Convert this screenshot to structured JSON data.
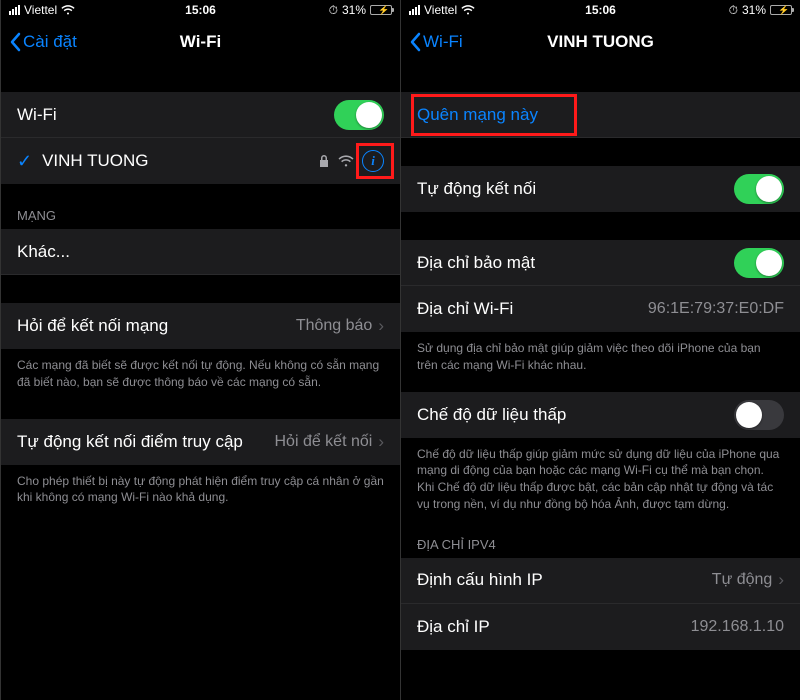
{
  "status": {
    "carrier": "Viettel",
    "time": "15:06",
    "battery_pct": "31%"
  },
  "left": {
    "back": "Cài đặt",
    "title": "Wi-Fi",
    "wifi_toggle_label": "Wi-Fi",
    "network_name": "VINH TUONG",
    "networks_header": "MẠNG",
    "other": "Khác...",
    "ask_join_label": "Hỏi để kết nối mạng",
    "ask_join_value": "Thông báo",
    "ask_join_note": "Các mạng đã biết sẽ được kết nối tự động. Nếu không có sẵn mạng đã biết nào, bạn sẽ được thông báo về các mạng có sẵn.",
    "hotspot_label": "Tự động kết nối điểm truy cập",
    "hotspot_value": "Hỏi để kết nối",
    "hotspot_note": "Cho phép thiết bị này tự động phát hiện điểm truy cập cá nhân ở gần khi không có mạng Wi-Fi nào khả dụng."
  },
  "right": {
    "back": "Wi-Fi",
    "title": "VINH TUONG",
    "forget": "Quên mạng này",
    "auto_join": "Tự động kết nối",
    "private_addr": "Địa chỉ bảo mật",
    "wifi_addr_label": "Địa chỉ Wi-Fi",
    "wifi_addr_value": "96:1E:79:37:E0:DF",
    "private_note": "Sử dụng địa chỉ bảo mật giúp giảm việc theo dõi iPhone của bạn trên các mạng Wi-Fi khác nhau.",
    "low_data": "Chế độ dữ liệu thấp",
    "low_data_note": "Chế độ dữ liệu thấp giúp giảm mức sử dụng dữ liệu của iPhone qua mạng di động của bạn hoặc các mạng Wi-Fi cụ thể mà bạn chọn. Khi Chế độ dữ liệu thấp được bật, các bản cập nhật tự động và tác vụ trong nền, ví dụ như đồng bộ hóa Ảnh, được tạm dừng.",
    "ipv4_header": "ĐỊA CHỈ IPV4",
    "ip_config_label": "Định cấu hình IP",
    "ip_config_value": "Tự động",
    "ip_addr_label": "Địa chỉ IP",
    "ip_addr_value": "192.168.1.10"
  }
}
